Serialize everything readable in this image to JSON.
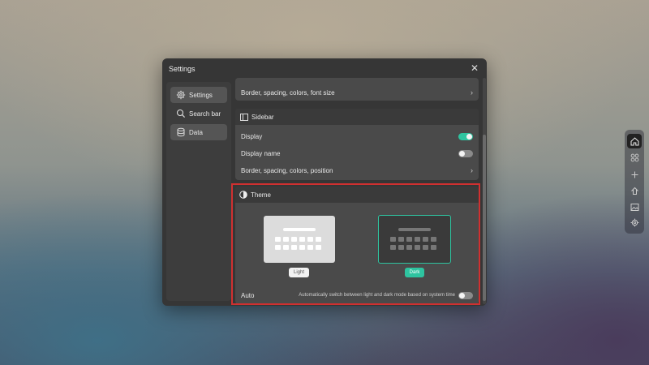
{
  "window": {
    "title": "Settings",
    "close_symbol": "✕"
  },
  "sidebar": {
    "items": [
      {
        "label": "Settings",
        "icon": "gear-icon",
        "active": true
      },
      {
        "label": "Search bar",
        "icon": "search-icon",
        "active": false
      },
      {
        "label": "Data",
        "icon": "database-icon",
        "active": false
      }
    ]
  },
  "search_section": {
    "row_label": "Border, spacing, colors, font size"
  },
  "sidebar_section": {
    "title": "Sidebar",
    "display_label": "Display",
    "display_on": true,
    "display_name_label": "Display name",
    "display_name_on": false,
    "border_row_label": "Border, spacing, colors, position"
  },
  "theme_section": {
    "title": "Theme",
    "light_label": "Light",
    "dark_label": "Dark",
    "selected": "Dark",
    "auto_label": "Auto",
    "auto_description": "Automatically switch between light and dark mode based on system time",
    "auto_on": false
  },
  "colors": {
    "accent": "#2ec4a0",
    "highlight": "#d03030"
  },
  "dock": {
    "items": [
      "home-icon",
      "apps-icon",
      "plus-icon",
      "upload-icon",
      "image-icon",
      "gear-icon"
    ]
  }
}
